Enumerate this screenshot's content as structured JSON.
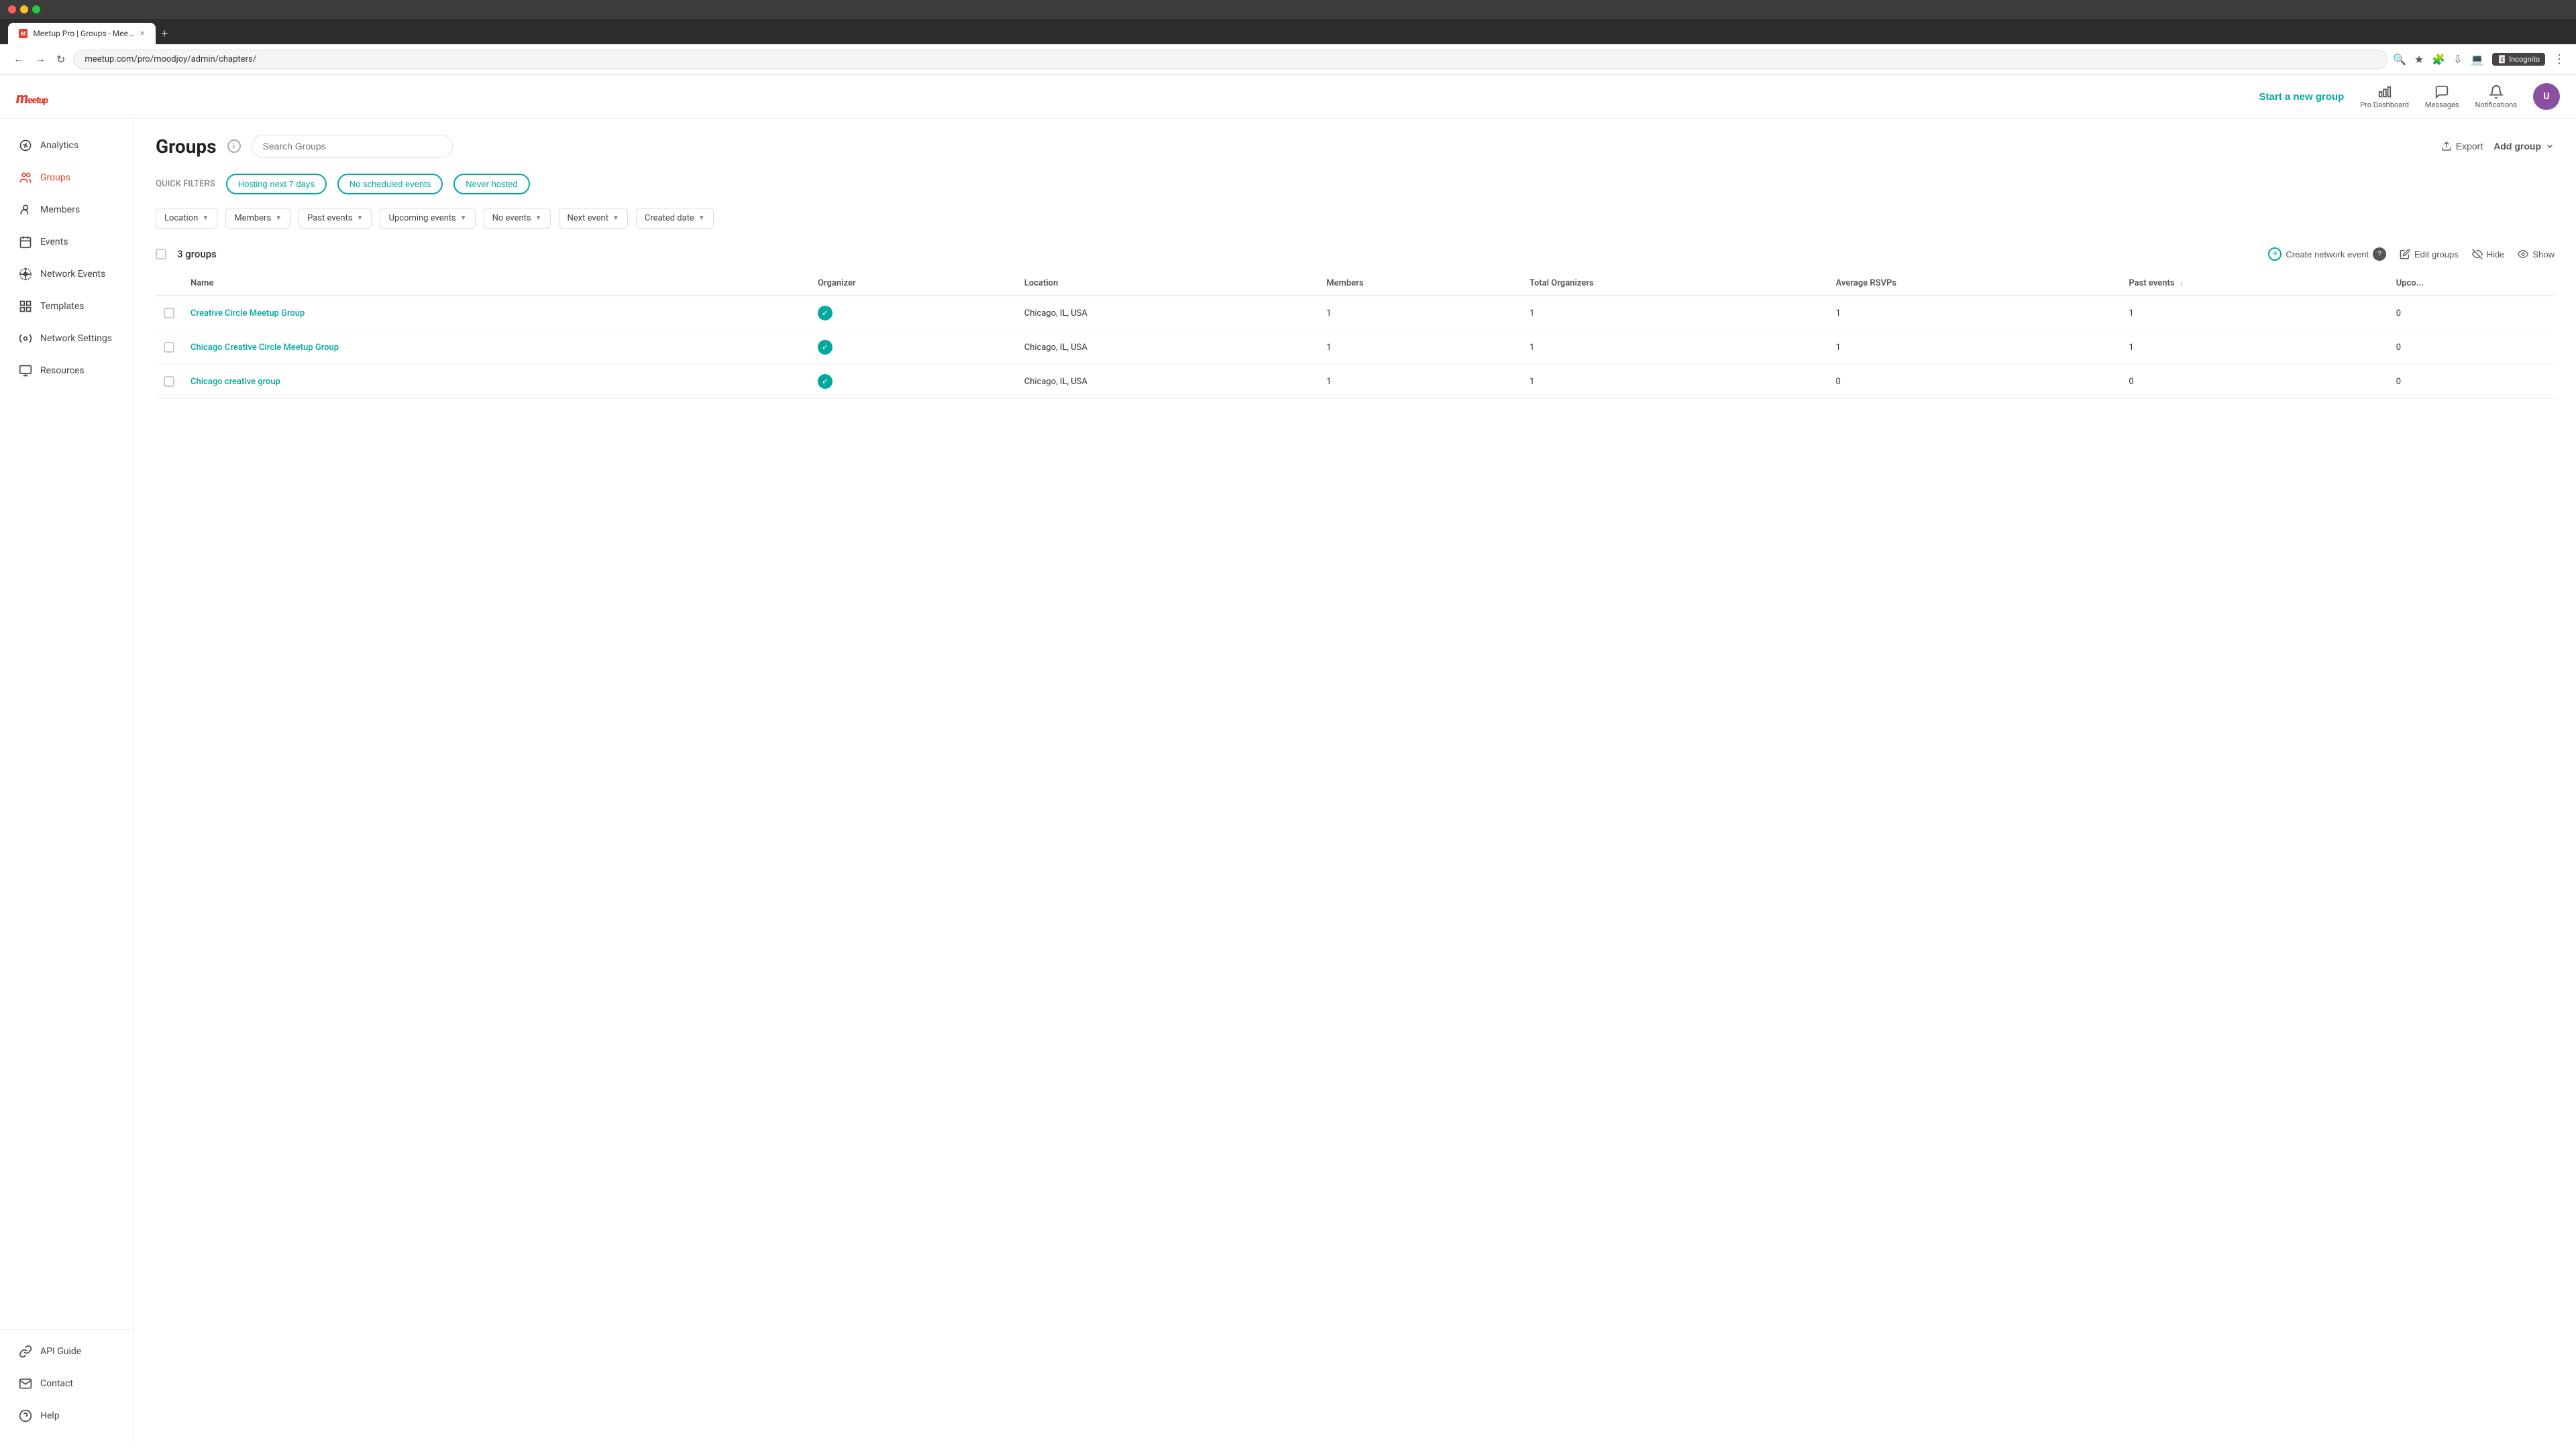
{
  "browser": {
    "tab_title": "Meetup Pro | Groups - Meetup",
    "url": "meetup.com/pro/moodjoy/admin/chapters/",
    "incognito_label": "Incognito"
  },
  "header": {
    "logo": "meetup",
    "start_group_label": "Start a new group",
    "pro_dashboard_label": "Pro Dashboard",
    "messages_label": "Messages",
    "notifications_label": "Notifications"
  },
  "sidebar": {
    "items": [
      {
        "id": "analytics",
        "label": "Analytics"
      },
      {
        "id": "groups",
        "label": "Groups",
        "active": true
      },
      {
        "id": "members",
        "label": "Members"
      },
      {
        "id": "events",
        "label": "Events"
      },
      {
        "id": "network-events",
        "label": "Network Events"
      },
      {
        "id": "templates",
        "label": "Templates"
      },
      {
        "id": "network-settings",
        "label": "Network Settings"
      },
      {
        "id": "resources",
        "label": "Resources"
      }
    ],
    "bottom_items": [
      {
        "id": "api-guide",
        "label": "API Guide"
      },
      {
        "id": "contact",
        "label": "Contact"
      },
      {
        "id": "help",
        "label": "Help"
      }
    ]
  },
  "page": {
    "title": "Groups",
    "search_placeholder": "Search Groups",
    "export_label": "Export",
    "add_group_label": "Add group"
  },
  "quick_filters": {
    "label": "QUICK FILTERS",
    "chips": [
      {
        "id": "hosting-next-7-days",
        "label": "Hosting next 7 days"
      },
      {
        "id": "no-scheduled-events",
        "label": "No scheduled events"
      },
      {
        "id": "never-hosted",
        "label": "Never hosted"
      }
    ]
  },
  "column_filters": [
    {
      "id": "location",
      "label": "Location"
    },
    {
      "id": "members",
      "label": "Members"
    },
    {
      "id": "past-events",
      "label": "Past events"
    },
    {
      "id": "upcoming-events",
      "label": "Upcoming events"
    },
    {
      "id": "no-events",
      "label": "No events"
    },
    {
      "id": "next-event",
      "label": "Next event"
    },
    {
      "id": "created-date",
      "label": "Created date"
    }
  ],
  "table": {
    "groups_count": "3 groups",
    "create_network_event_label": "Create network event",
    "edit_groups_label": "Edit groups",
    "hide_label": "Hide",
    "show_label": "Show",
    "columns": [
      {
        "id": "name",
        "label": "Name"
      },
      {
        "id": "organizer",
        "label": "Organizer"
      },
      {
        "id": "location",
        "label": "Location"
      },
      {
        "id": "members",
        "label": "Members"
      },
      {
        "id": "total-organizers",
        "label": "Total Organizers"
      },
      {
        "id": "average-rsvps",
        "label": "Average RSVPs"
      },
      {
        "id": "past-events",
        "label": "Past events",
        "sorted": true
      },
      {
        "id": "upcoming-events",
        "label": "Upco..."
      }
    ],
    "rows": [
      {
        "id": "row-1",
        "name": "Creative Circle Meetup Group",
        "has_organizer": true,
        "location": "Chicago, IL, USA",
        "members": "1",
        "total_organizers": "1",
        "average_rsvps": "1",
        "past_events": "1",
        "upcoming_events": "0"
      },
      {
        "id": "row-2",
        "name": "Chicago Creative Circle Meetup Group",
        "has_organizer": true,
        "location": "Chicago, IL, USA",
        "members": "1",
        "total_organizers": "1",
        "average_rsvps": "1",
        "past_events": "1",
        "upcoming_events": "0"
      },
      {
        "id": "row-3",
        "name": "Chicago creative group",
        "has_organizer": true,
        "location": "Chicago, IL, USA",
        "members": "1",
        "total_organizers": "1",
        "average_rsvps": "0",
        "past_events": "0",
        "upcoming_events": "0"
      }
    ]
  },
  "colors": {
    "teal": "#00a99d",
    "red": "#e53e2f",
    "text_dark": "#222",
    "text_mid": "#555",
    "text_light": "#888"
  }
}
